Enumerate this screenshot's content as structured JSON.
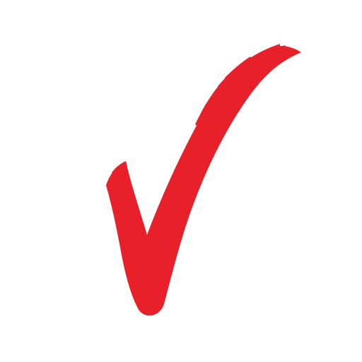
{
  "image": {
    "background_color": "#ffffff",
    "mark": {
      "icon": "checkmark-icon",
      "style": "brush-stroke",
      "color": "#e8202a"
    }
  }
}
